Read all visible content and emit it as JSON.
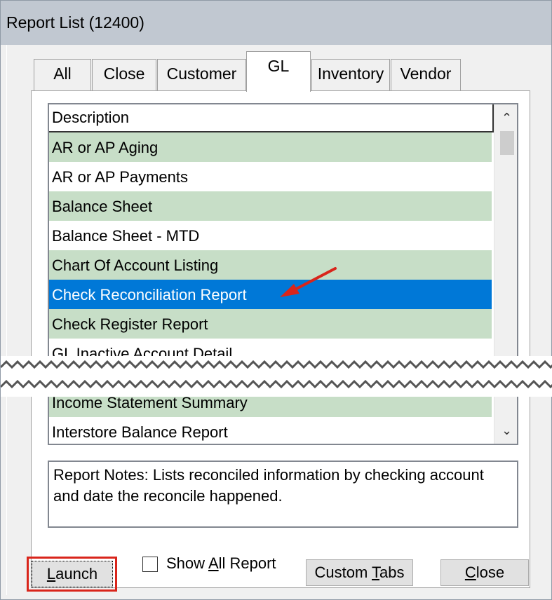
{
  "window": {
    "title": "Report List (12400)"
  },
  "tabs": [
    {
      "label": "All",
      "active": false
    },
    {
      "label": "Close",
      "active": false
    },
    {
      "label": "Customer",
      "active": false
    },
    {
      "label": "GL",
      "active": true
    },
    {
      "label": "Inventory",
      "active": false
    },
    {
      "label": "Vendor",
      "active": false
    }
  ],
  "list": {
    "header": "Description",
    "rows": [
      "AR or AP Aging",
      "AR or AP Payments",
      "Balance Sheet",
      "Balance Sheet - MTD",
      "Chart Of Account Listing",
      "Check Reconciliation Report",
      "Check Register Report",
      "GL Inactive Account Detail",
      "Income Statement Summary",
      "Interstore Balance Report"
    ],
    "selected_index": 5
  },
  "notes": {
    "text": "Report Notes:  Lists reconciled information by checking account and date the reconcile happened."
  },
  "buttons": {
    "launch": {
      "pre": "",
      "key": "L",
      "post": "aunch"
    },
    "show_all": {
      "pre": "Show ",
      "key": "A",
      "post": "ll Report"
    },
    "custom_tabs": {
      "pre": "Custom ",
      "key": "T",
      "post": "abs"
    },
    "close": {
      "pre": "",
      "key": "C",
      "post": "lose"
    }
  },
  "colors": {
    "accent_select": "#0078d7",
    "row_alt": "#c7dec7",
    "highlight": "#d9251b"
  },
  "icons": {
    "arrow": "red-arrow-icon",
    "scroll_up": "chevron-up-icon",
    "scroll_down": "chevron-down-icon"
  }
}
